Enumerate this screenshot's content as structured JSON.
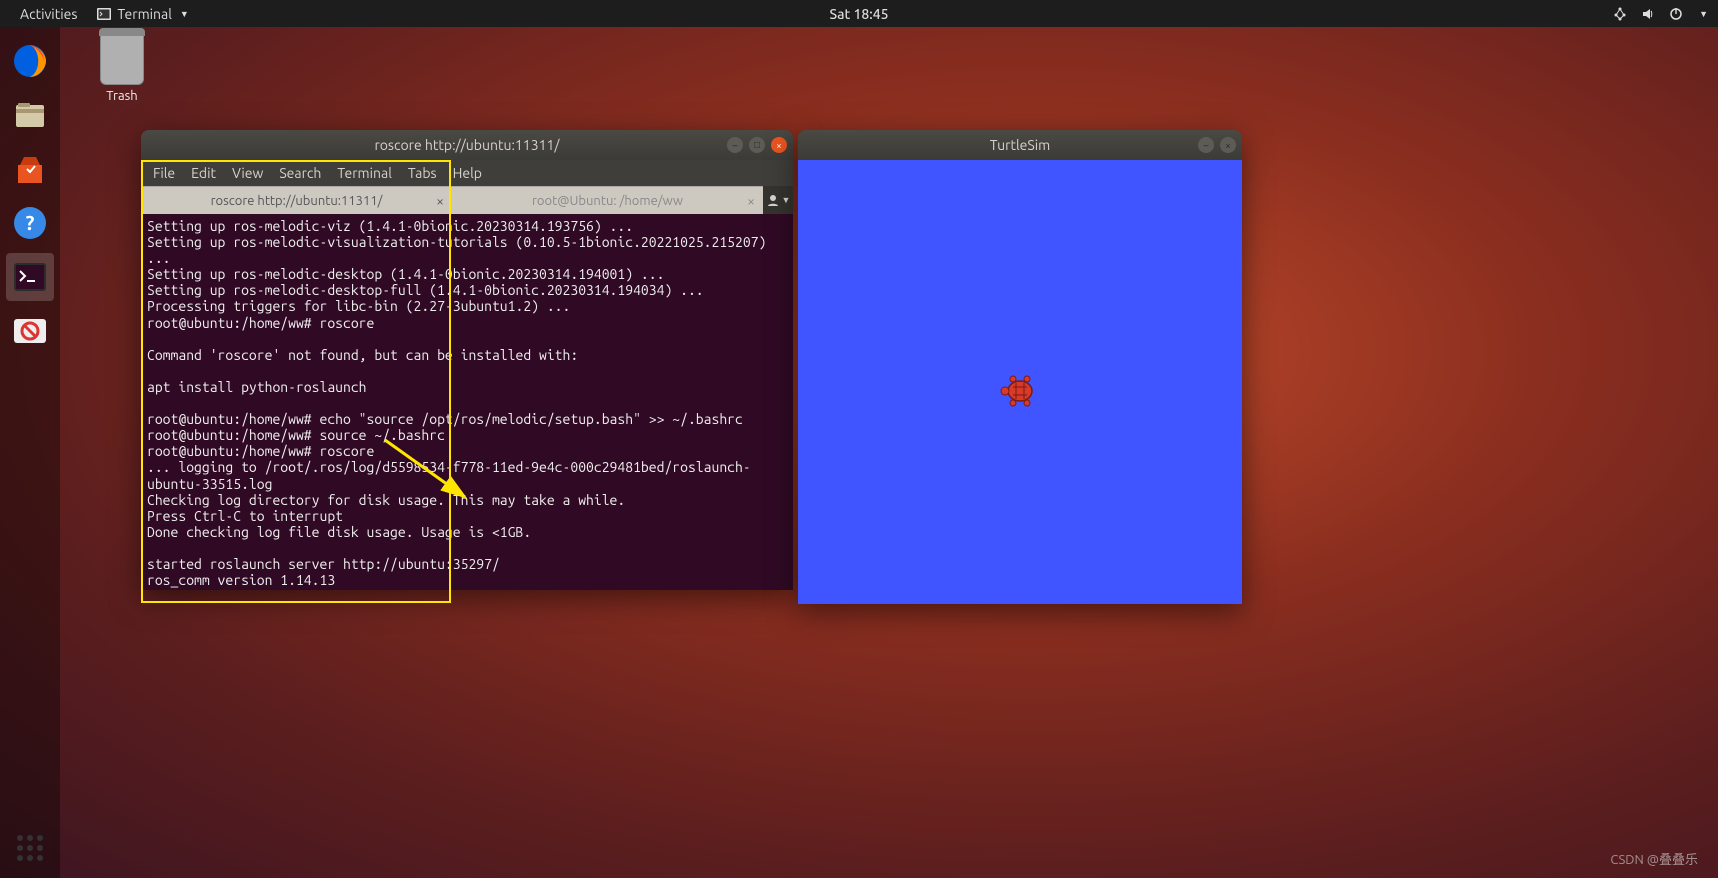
{
  "topbar": {
    "activities": "Activities",
    "app_label": "Terminal",
    "clock": "Sat 18:45"
  },
  "desktop": {
    "trash_label": "Trash"
  },
  "terminal": {
    "title": "roscore http://ubuntu:11311/",
    "menus": [
      "File",
      "Edit",
      "View",
      "Search",
      "Terminal",
      "Tabs",
      "Help"
    ],
    "tabs": [
      {
        "label": "roscore http://ubuntu:11311/",
        "active": true
      },
      {
        "label": "root@Ubuntu: /home/ww",
        "active": false
      }
    ],
    "output": "Setting up ros-melodic-viz (1.4.1-0bionic.20230314.193756) ...\nSetting up ros-melodic-visualization-tutorials (0.10.5-1bionic.20221025.215207) ...\nSetting up ros-melodic-desktop (1.4.1-0bionic.20230314.194001) ...\nSetting up ros-melodic-desktop-full (1.4.1-0bionic.20230314.194034) ...\nProcessing triggers for libc-bin (2.27-3ubuntu1.2) ...\nroot@ubuntu:/home/ww# roscore\n\nCommand 'roscore' not found, but can be installed with:\n\napt install python-roslaunch\n\nroot@ubuntu:/home/ww# echo \"source /opt/ros/melodic/setup.bash\" >> ~/.bashrc\nroot@ubuntu:/home/ww# source ~/.bashrc\nroot@ubuntu:/home/ww# roscore\n... logging to /root/.ros/log/d5598534-f778-11ed-9e4c-000c29481bed/roslaunch-ubuntu-33515.log\nChecking log directory for disk usage. This may take a while.\nPress Ctrl-C to interrupt\nDone checking log file disk usage. Usage is <1GB.\n\nstarted roslaunch server http://ubuntu:35297/\nros_comm version 1.14.13"
  },
  "turtlesim": {
    "title": "TurtleSim"
  },
  "watermark": "CSDN @叠叠乐"
}
